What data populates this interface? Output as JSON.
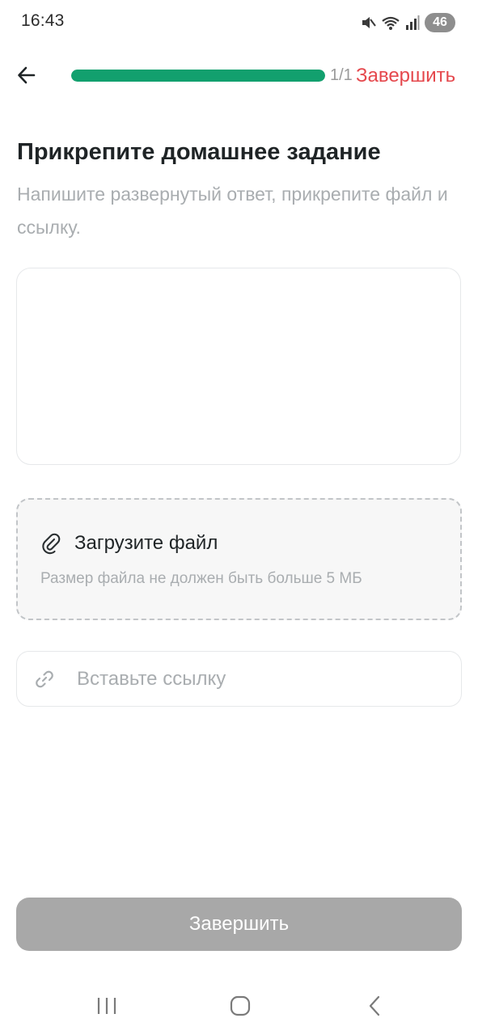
{
  "status_bar": {
    "time": "16:43",
    "battery": "46",
    "icons": [
      "mute-icon",
      "wifi-icon",
      "signal-icon",
      "battery-icon"
    ]
  },
  "header": {
    "progress": 1.0,
    "progress_count": "1/1",
    "finish_label": "Завершить"
  },
  "main": {
    "title": "Прикрепите домашнее задание",
    "subtitle": "Напишите развернутый ответ, прикрепите файл и ссылку.",
    "answer_value": "",
    "upload": {
      "title": "Загрузите файл",
      "hint": "Размер файла не должен быть больше 5 МБ",
      "icon": "paperclip-icon"
    },
    "link": {
      "placeholder": "Вставьте ссылку",
      "icon": "link-icon"
    },
    "submit_label": "Завершить"
  },
  "system_nav": {
    "buttons": [
      "recent-apps-icon",
      "home-icon",
      "back-nav-icon"
    ]
  },
  "colors": {
    "accent": "#12a06e",
    "danger": "#e5484d",
    "disabled_button": "#a8a8a8"
  }
}
